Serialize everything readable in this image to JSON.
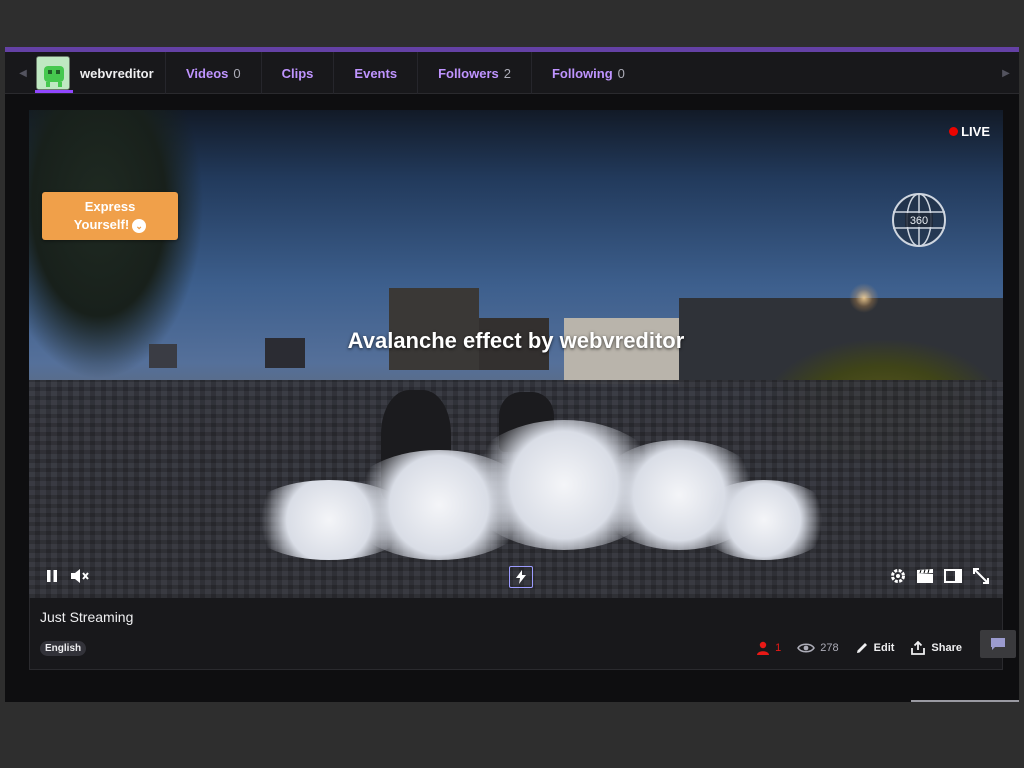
{
  "channel": {
    "name": "webvreditor"
  },
  "tabs": [
    {
      "label": "Videos",
      "count": "0"
    },
    {
      "label": "Clips",
      "count": ""
    },
    {
      "label": "Events",
      "count": ""
    },
    {
      "label": "Followers",
      "count": "2"
    },
    {
      "label": "Following",
      "count": "0"
    }
  ],
  "player": {
    "live_label": "LIVE",
    "express_line1": "Express",
    "express_line2": "Yourself!",
    "globe_label": "360",
    "overlay_title": "Avalanche effect by webvreditor"
  },
  "stream": {
    "title": "Just Streaming",
    "language": "English",
    "viewers": "1",
    "views": "278",
    "edit_label": "Edit",
    "share_label": "Share"
  },
  "colors": {
    "accent": "#6441a5",
    "tab_text": "#bf94ff",
    "live_red": "#eb0400",
    "express_orange": "#f0a04a"
  },
  "icons": {
    "nav_left": "triangle-left-icon",
    "nav_right": "triangle-right-icon",
    "globe": "globe-360-icon",
    "pause": "pause-icon",
    "mute": "muted-speaker-icon",
    "boost": "lightning-icon",
    "settings": "gear-icon",
    "clip": "clapperboard-icon",
    "theatre": "theatre-mode-icon",
    "fullscreen": "fullscreen-icon",
    "viewers": "person-icon",
    "views": "eye-icon",
    "edit": "pencil-icon",
    "share": "share-icon",
    "more": "vertical-dots-icon",
    "chat": "chat-bubble-icon"
  }
}
